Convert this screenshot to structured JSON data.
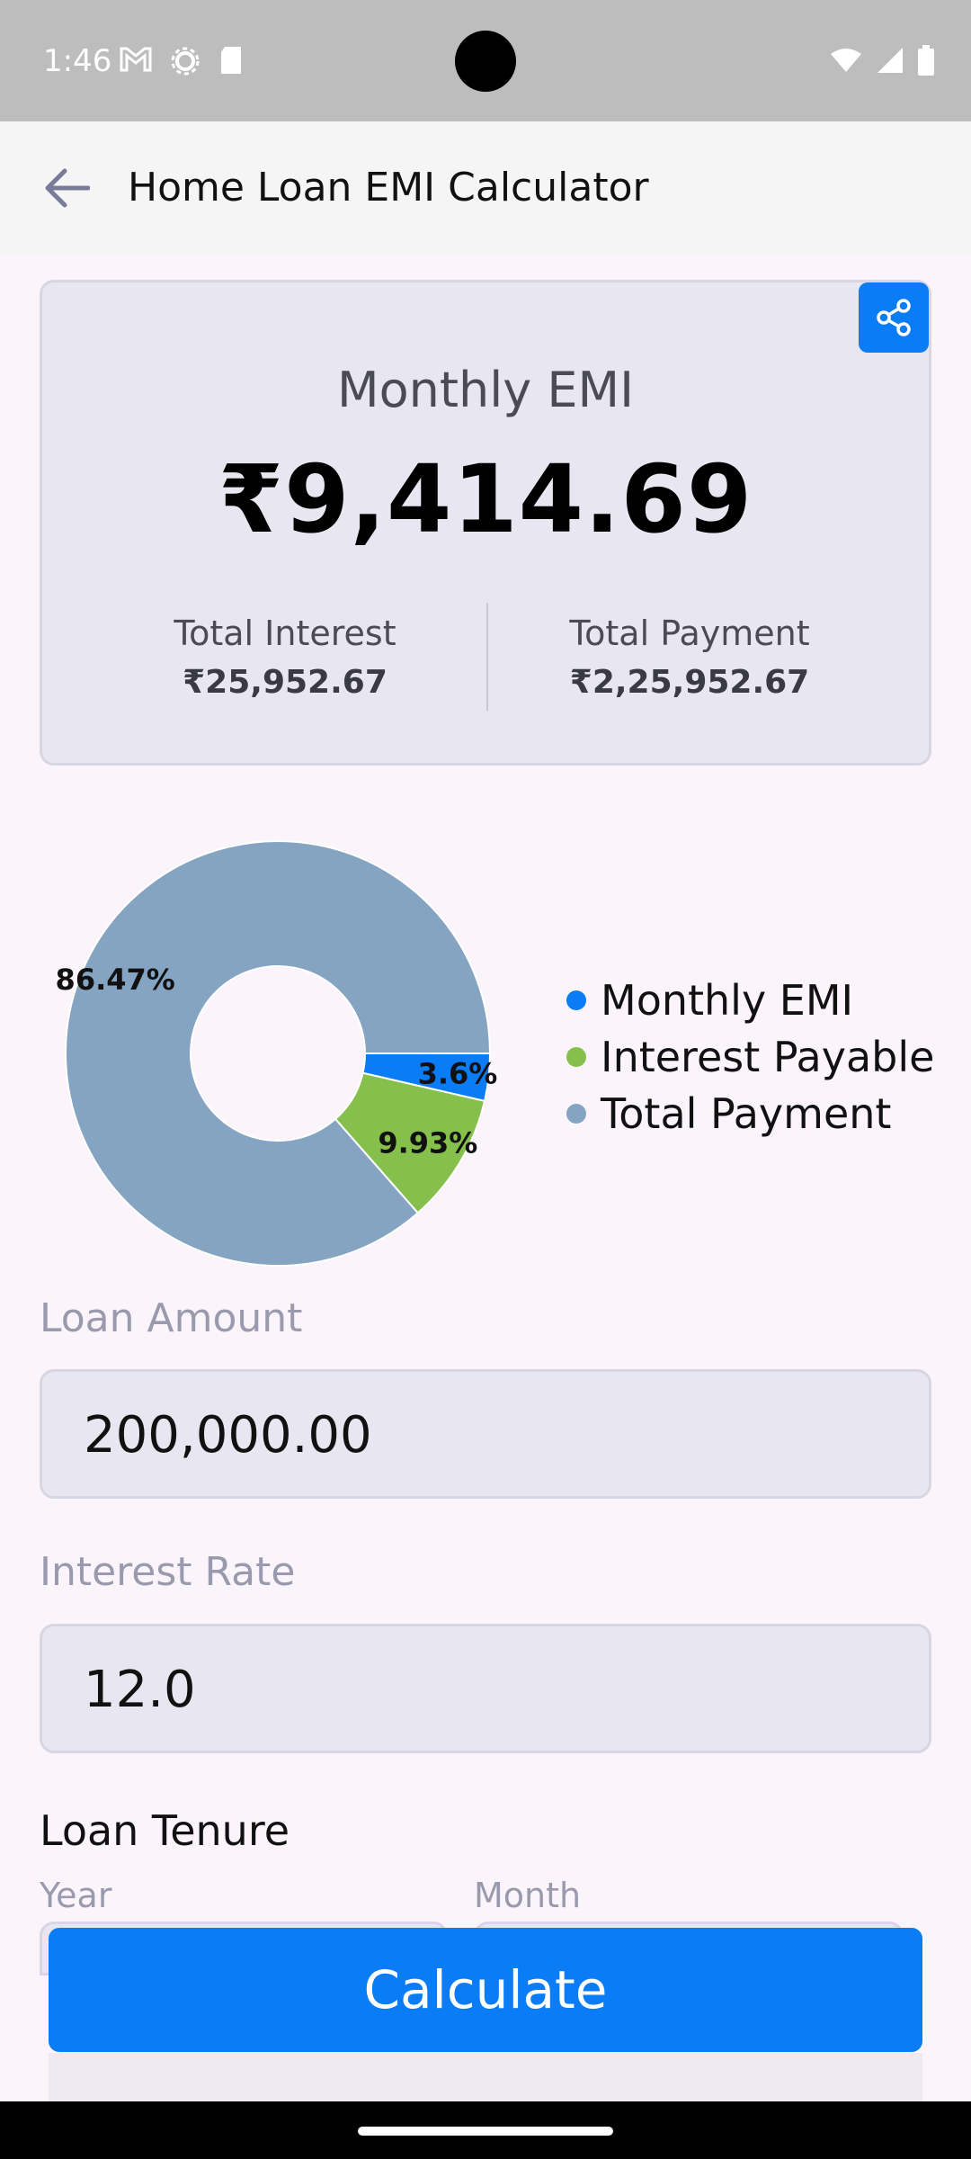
{
  "status_bar": {
    "time": "1:46"
  },
  "app_bar": {
    "title": "Home Loan EMI Calculator",
    "back_icon": "arrow-left-icon"
  },
  "summary": {
    "emi_label": "Monthly EMI",
    "emi_value": "₹9,414.69",
    "total_interest_label": "Total Interest",
    "total_interest_value": "₹25,952.67",
    "total_payment_label": "Total Payment",
    "total_payment_value": "₹2,25,952.67",
    "share_icon": "share-icon"
  },
  "chart_data": {
    "type": "pie",
    "donut": true,
    "slices": [
      {
        "name": "Monthly EMI",
        "value": 3.6,
        "label": "3.6%",
        "color": "#0a7cf5"
      },
      {
        "name": "Interest Payable",
        "value": 9.93,
        "label": "9.93%",
        "color": "#86c04c"
      },
      {
        "name": "Total Payment",
        "value": 86.47,
        "label": "86.47%",
        "color": "#84a4c2"
      }
    ],
    "legend_placement": "right"
  },
  "legend": {
    "items": [
      "Monthly EMI",
      "Interest Payable",
      "Total Payment"
    ]
  },
  "form": {
    "loan_amount_label": "Loan Amount",
    "loan_amount_value": "200,000.00",
    "interest_rate_label": "Interest Rate",
    "interest_rate_value": "12.0",
    "tenure_title": "Loan Tenure",
    "year_label": "Year",
    "month_label": "Month"
  },
  "actions": {
    "calculate_label": "Calculate"
  },
  "colors": {
    "accent": "#0a7cf5",
    "card": "#e8e6f1",
    "background": "#fbf5fb"
  }
}
